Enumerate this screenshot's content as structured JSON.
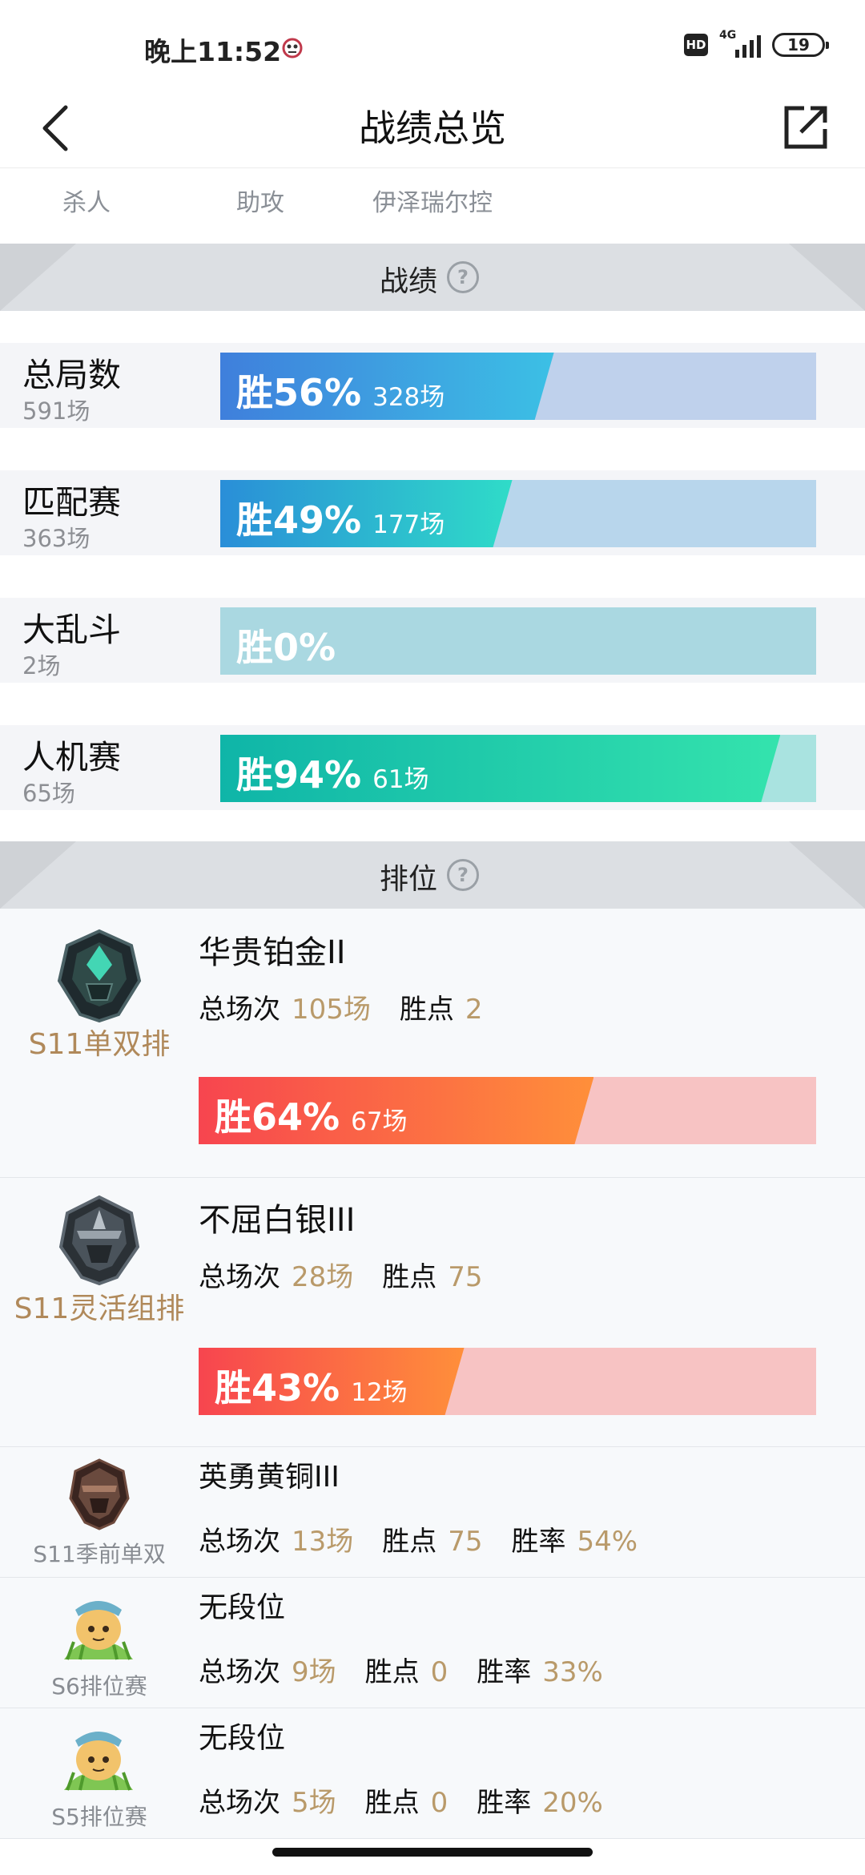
{
  "status_bar": {
    "time": "晚上11:52",
    "hd": "HD",
    "network": "4G",
    "battery": "19"
  },
  "header": {
    "title": "战绩总览"
  },
  "tabs": [
    "杀人",
    "助攻",
    "伊泽瑞尔控"
  ],
  "stats_section": {
    "title": "战绩",
    "rows": [
      {
        "name": "总局数",
        "count": "591场",
        "win_label": "胜56%",
        "games": "328场",
        "win_rate": 56,
        "colors": [
          "#3f7fdc",
          "#3cc0e5"
        ],
        "track": "#bfd1ec"
      },
      {
        "name": "匹配赛",
        "count": "363场",
        "win_label": "胜49%",
        "games": "177场",
        "win_rate": 49,
        "colors": [
          "#2a8ed8",
          "#2fdcc8"
        ],
        "track": "#b8d6ec"
      },
      {
        "name": "大乱斗",
        "count": "2场",
        "win_label": "胜0%",
        "games": "",
        "win_rate": 0,
        "colors": [
          "#aad8e1",
          "#aad8e1"
        ],
        "track": "#aad8e1"
      },
      {
        "name": "人机赛",
        "count": "65场",
        "win_label": "胜94%",
        "games": "61场",
        "win_rate": 94,
        "colors": [
          "#0fb5a8",
          "#34e3ad"
        ],
        "track": "#a9e3e0"
      }
    ]
  },
  "ranked_section": {
    "title": "排位",
    "labels": {
      "total": "总场次",
      "points": "胜点",
      "rate": "胜率"
    },
    "big": [
      {
        "season": "S11单双排",
        "tier": "华贵铂金II",
        "total": "105场",
        "points": "2",
        "win_label": "胜64%",
        "games": "67场",
        "win_rate": 64,
        "emblem": "platinum-emblem"
      },
      {
        "season": "S11灵活组排",
        "tier": "不屈白银III",
        "total": "28场",
        "points": "75",
        "win_label": "胜43%",
        "games": "12场",
        "win_rate": 43,
        "emblem": "silver-emblem"
      }
    ],
    "small": [
      {
        "season": "S11季前单双",
        "tier": "英勇黄铜III",
        "total": "13场",
        "points": "75",
        "rate": "54%",
        "emblem": "bronze-emblem"
      },
      {
        "season": "S6排位赛",
        "tier": "无段位",
        "total": "9场",
        "points": "0",
        "rate": "33%",
        "emblem": "teemo-emblem"
      },
      {
        "season": "S5排位赛",
        "tier": "无段位",
        "total": "5场",
        "points": "0",
        "rate": "20%",
        "emblem": "teemo-emblem"
      }
    ]
  }
}
